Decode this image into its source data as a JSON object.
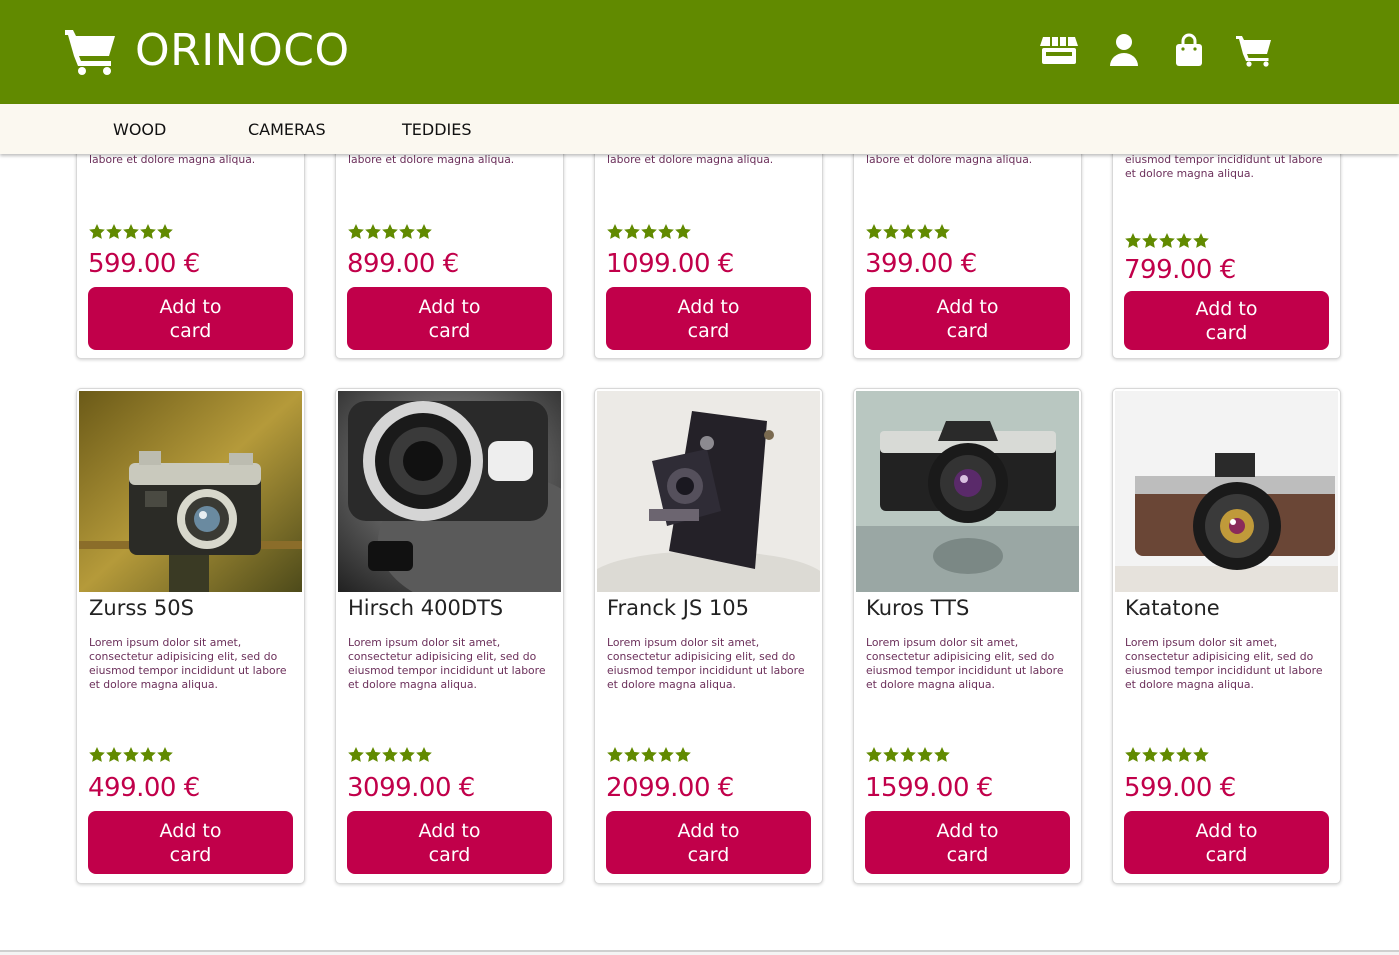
{
  "header": {
    "brand": "ORINOCO",
    "colors": {
      "header_bg": "#618a00",
      "nav_bg": "#fbf8f0",
      "accent": "#c1004a",
      "star": "#618a00"
    },
    "icons": [
      "store-icon",
      "user-icon",
      "shopping-bag-icon",
      "cart-icon"
    ]
  },
  "nav": {
    "items": [
      "WOOD",
      "CAMERAS",
      "TEDDIES"
    ]
  },
  "top_row": [
    {
      "desc_visible": "labore et dolore magna aliqua.",
      "rating": 5,
      "price": "599.00 €",
      "button": "Add to card"
    },
    {
      "desc_visible": "labore et dolore magna aliqua.",
      "rating": 5,
      "price": "899.00 €",
      "button": "Add to card"
    },
    {
      "desc_visible": "labore et dolore magna aliqua.",
      "rating": 5,
      "price": "1099.00 €",
      "button": "Add to card"
    },
    {
      "desc_visible": "labore et dolore magna aliqua.",
      "rating": 5,
      "price": "399.00 €",
      "button": "Add to card"
    },
    {
      "desc_visible": "eiusmod tempor incididunt ut labore et dolore magna aliqua.",
      "rating": 5,
      "price": "799.00 €",
      "button": "Add to card"
    }
  ],
  "products": [
    {
      "name": "Zurss 50S",
      "image": "camera-photo",
      "description": "Lorem ipsum dolor sit amet, consectetur adipisicing elit, sed do eiusmod tempor incididunt ut labore et dolore magna aliqua.",
      "rating": 5,
      "price": "499.00 €",
      "button": "Add to card"
    },
    {
      "name": "Hirsch 400DTS",
      "image": "camera-photo",
      "description": "Lorem ipsum dolor sit amet, consectetur adipisicing elit, sed do eiusmod tempor incididunt ut labore et dolore magna aliqua.",
      "rating": 5,
      "price": "3099.00 €",
      "button": "Add to card"
    },
    {
      "name": "Franck JS 105",
      "image": "camera-photo",
      "description": "Lorem ipsum dolor sit amet, consectetur adipisicing elit, sed do eiusmod tempor incididunt ut labore et dolore magna aliqua.",
      "rating": 5,
      "price": "2099.00 €",
      "button": "Add to card"
    },
    {
      "name": "Kuros TTS",
      "image": "camera-photo",
      "description": "Lorem ipsum dolor sit amet, consectetur adipisicing elit, sed do eiusmod tempor incididunt ut labore et dolore magna aliqua.",
      "rating": 5,
      "price": "1599.00 €",
      "button": "Add to card"
    },
    {
      "name": "Katatone",
      "image": "camera-photo",
      "description": "Lorem ipsum dolor sit amet, consectetur adipisicing elit, sed do eiusmod tempor incididunt ut labore et dolore magna aliqua.",
      "rating": 5,
      "price": "599.00 €",
      "button": "Add to card"
    }
  ]
}
